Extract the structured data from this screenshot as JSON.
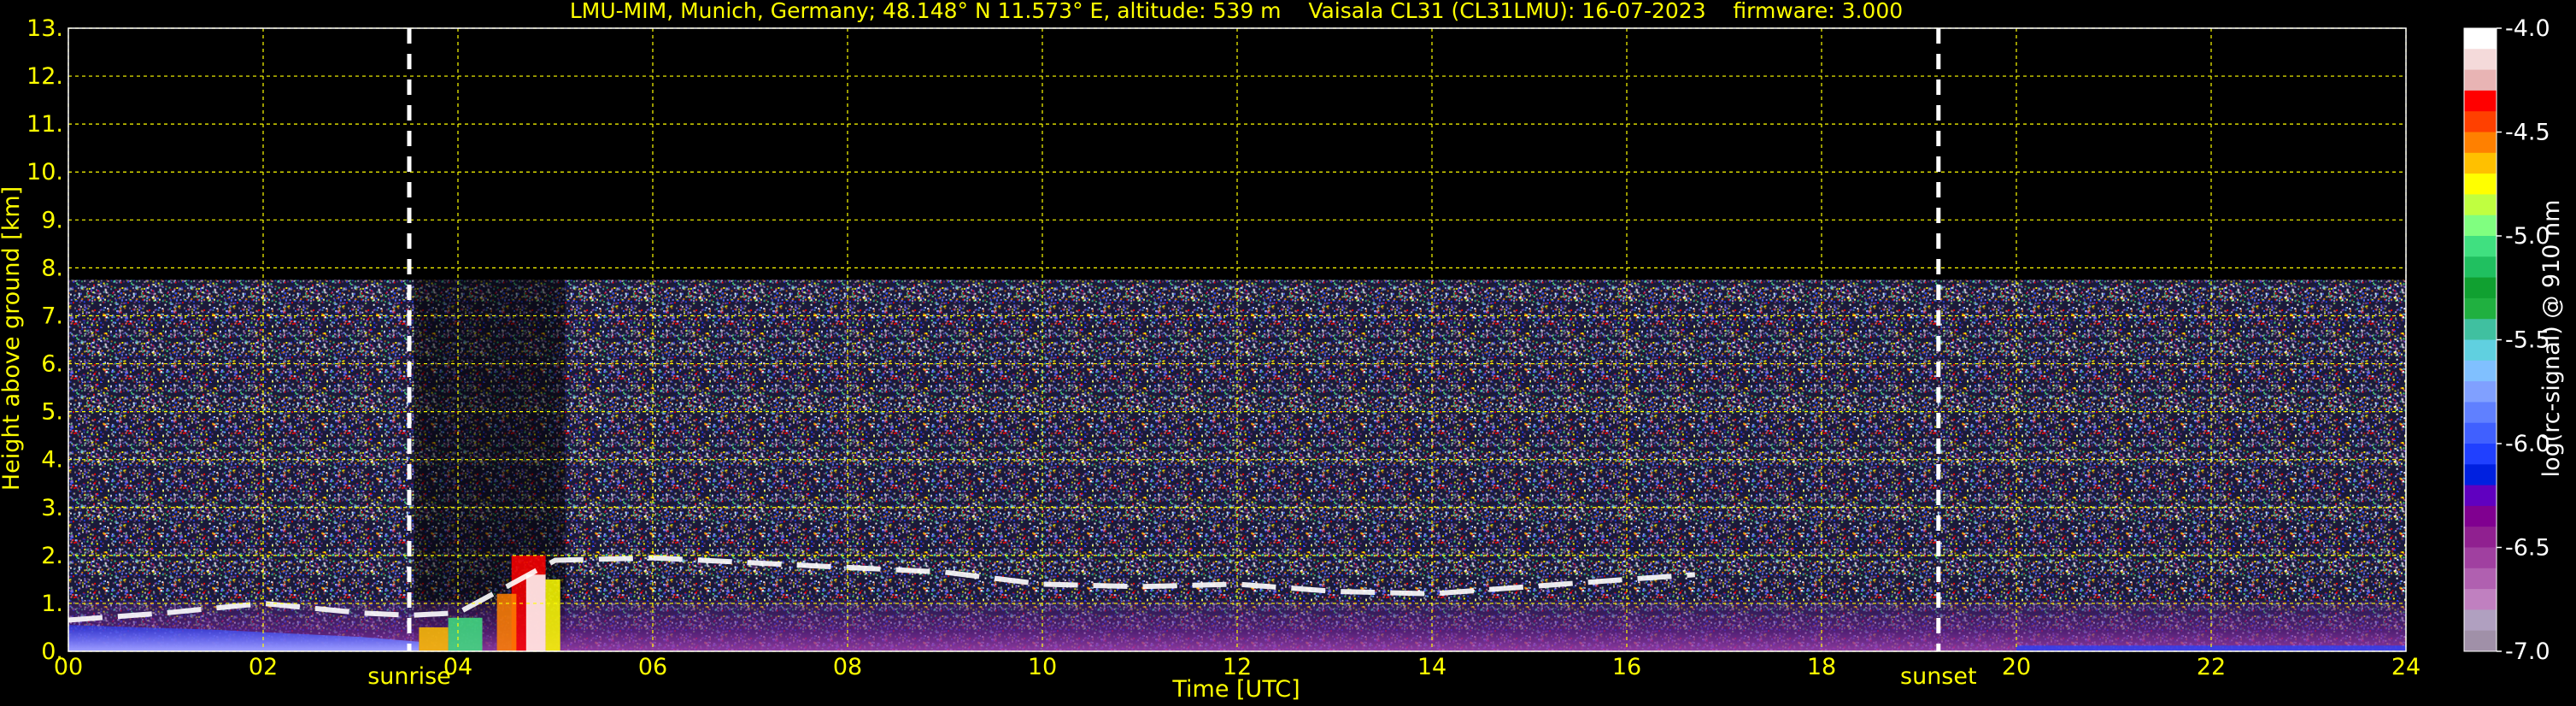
{
  "chart_data": {
    "type": "heatmap",
    "title": "LMU-MIM, Munich, Germany; 48.148° N 11.573° E, altitude: 539 m    Vaisala CL31 (CL31LMU): 16-07-2023    firmware: 3.000",
    "xlabel": "Time [UTC]",
    "ylabel": "Height above ground [km]",
    "xlim": [
      0,
      24
    ],
    "ylim": [
      0,
      13
    ],
    "x_ticks": [
      "00",
      "02",
      "04",
      "06",
      "08",
      "10",
      "12",
      "14",
      "16",
      "18",
      "20",
      "22",
      "24"
    ],
    "y_ticks": [
      "0.",
      "1.",
      "2.",
      "3.",
      "4.",
      "5.",
      "6.",
      "7.",
      "8.",
      "9.",
      "10.",
      "11.",
      "12.",
      "13."
    ],
    "grid": true,
    "signal_top_km": 7.75,
    "events": [
      {
        "label": "sunrise",
        "time_h": 3.5
      },
      {
        "label": "sunset",
        "time_h": 19.2
      }
    ],
    "cloud_base_layer": [
      {
        "x": 0.0,
        "y": 0.65
      },
      {
        "x": 1.0,
        "y": 0.8
      },
      {
        "x": 2.0,
        "y": 1.0
      },
      {
        "x": 3.0,
        "y": 0.8
      },
      {
        "x": 3.5,
        "y": 0.75
      },
      {
        "x": 4.0,
        "y": 0.8
      },
      {
        "x": 5.0,
        "y": 1.9
      },
      {
        "x": 6.0,
        "y": 1.95
      },
      {
        "x": 7.0,
        "y": 1.85
      },
      {
        "x": 8.0,
        "y": 1.75
      },
      {
        "x": 9.0,
        "y": 1.65
      },
      {
        "x": 10.0,
        "y": 1.4
      },
      {
        "x": 11.0,
        "y": 1.35
      },
      {
        "x": 12.0,
        "y": 1.4
      },
      {
        "x": 13.0,
        "y": 1.25
      },
      {
        "x": 14.0,
        "y": 1.2
      },
      {
        "x": 15.0,
        "y": 1.35
      },
      {
        "x": 16.0,
        "y": 1.5
      },
      {
        "x": 16.7,
        "y": 1.6
      }
    ],
    "colorbar": {
      "label": "log(rc-signal) @ 910 nm",
      "range": [
        -7.0,
        -4.0
      ],
      "tick_labels": [
        "-4.0",
        "-4.5",
        "-5.0",
        "-5.5",
        "-6.0",
        "-6.5",
        "-7.0"
      ],
      "colors": [
        "#ffffff",
        "#f4dada",
        "#e8b4b4",
        "#ff0000",
        "#ff4000",
        "#ff8000",
        "#ffc000",
        "#ffff00",
        "#c0ff40",
        "#80ff80",
        "#40e080",
        "#20c060",
        "#10a030",
        "#20b040",
        "#40c0a0",
        "#60d0e0",
        "#80c0ff",
        "#80a0ff",
        "#6080ff",
        "#4060ff",
        "#2040ff",
        "#0020e0",
        "#6000c0",
        "#800090",
        "#902090",
        "#a040a0",
        "#b060b0",
        "#c080c0",
        "#b0a0c0",
        "#a090a8"
      ]
    }
  }
}
